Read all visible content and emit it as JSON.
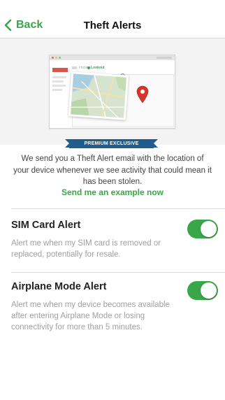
{
  "nav": {
    "back_label": "Back",
    "title": "Theft Alerts",
    "back_icon": "chevron-left-icon"
  },
  "hero": {
    "from_label": "FROM:",
    "brand_label": "Lookout",
    "badge": "PREMIUM EXCLUSIVE"
  },
  "intro": {
    "description": "We send you a Theft Alert email with the location of your device whenever we see activity that could mean it has been stolen.",
    "example_link": "Send me an example now"
  },
  "settings": [
    {
      "title": "SIM Card Alert",
      "description": "Alert me when my SIM card is removed or replaced, potentially for resale.",
      "enabled": true
    },
    {
      "title": "Airplane Mode Alert",
      "description": "Alert me when my device becomes available after entering Airplane Mode or losing connectivity for more than 5 minutes.",
      "enabled": true
    }
  ],
  "colors": {
    "accent": "#3aa64a",
    "ribbon": "#1f5e8c",
    "alarm": "#3aa64a",
    "pin": "#d9342b"
  }
}
